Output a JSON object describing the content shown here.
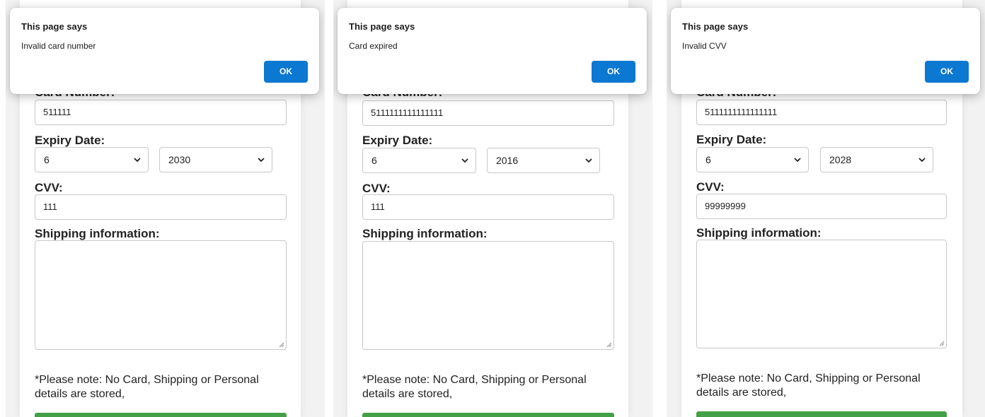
{
  "colors": {
    "accent": "#0b78d1",
    "submit_green": "#43a047",
    "page_background": "#f2f2f2"
  },
  "labels": {
    "card_number": "Card Number:",
    "expiry_date": "Expiry Date:",
    "cvv": "CVV:",
    "shipping": "Shipping information:",
    "note_line1": "*Please note: No Card, Shipping or Personal",
    "note_line2": "details are stored,"
  },
  "panels": [
    {
      "dialog": {
        "title": "This page says",
        "message": "Invalid card number",
        "ok_label": "OK"
      },
      "form": {
        "card_number": "511111",
        "expiry_month": "6",
        "expiry_year": "2030",
        "cvv": "111",
        "shipping": ""
      }
    },
    {
      "dialog": {
        "title": "This page says",
        "message": "Card expired",
        "ok_label": "OK"
      },
      "form": {
        "card_number": "5111111111111111",
        "expiry_month": "6",
        "expiry_year": "2016",
        "cvv": "111",
        "shipping": ""
      }
    },
    {
      "dialog": {
        "title": "This page says",
        "message": "Invalid CVV",
        "ok_label": "OK"
      },
      "form": {
        "card_number": "5111111111111111",
        "expiry_month": "6",
        "expiry_year": "2028",
        "cvv": "99999999",
        "shipping": ""
      }
    }
  ]
}
